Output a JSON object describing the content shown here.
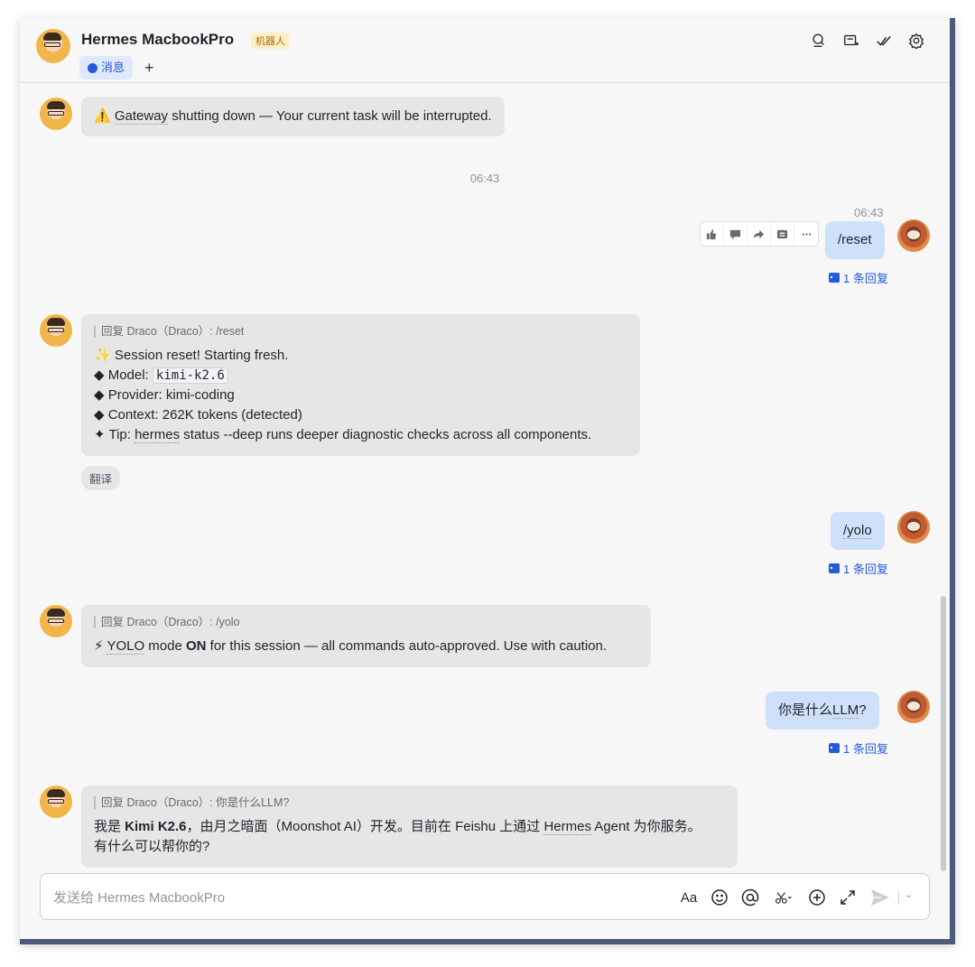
{
  "header": {
    "title": "Hermes MacbookPro",
    "badge": "机器人",
    "tab_label": "消息",
    "add_tab": "+",
    "icons": [
      "search-icon",
      "add-tab-icon",
      "check-icon",
      "settings-icon"
    ]
  },
  "messages": {
    "gateway": {
      "warn": "⚠️ ",
      "word": "Gateway",
      "rest": " shutting down — Your current task will be interrupted."
    },
    "time1": "06:43",
    "reset_time": "06:43",
    "reset_text": "/reset",
    "reply_count_1": "1 条回复",
    "reply_reset": {
      "quote": "回复 Draco（Draco）: /reset",
      "line1": "✨ Session reset! Starting fresh.",
      "line2_prefix": "◆ Model: ",
      "line2_code": "kimi-k2.6",
      "line3": "◆ Provider: kimi-coding",
      "line4": "◆ Context: 262K tokens (detected)",
      "line5_prefix": "✦ Tip: ",
      "line5_word": "hermes",
      "line5_rest": " status --deep runs deeper diagnostic checks across all components."
    },
    "translate": "翻译",
    "yolo_text": "/yolo",
    "reply_count_2": "1 条回复",
    "reply_yolo": {
      "quote": "回复 Draco（Draco）: /yolo",
      "prefix": "⚡ ",
      "word": "YOLO",
      "mid": " mode ",
      "bold": "ON",
      "rest": " for this session — all commands auto-approved. Use with caution."
    },
    "llm_q_prefix": "你是什么",
    "llm_q_word": "LLM",
    "llm_q_suffix": "?",
    "reply_count_3": "1 条回复",
    "reply_llm": {
      "quote": "回复 Draco（Draco）: 你是什么LLM?",
      "a": "我是 ",
      "bold": "Kimi K2.6",
      "b": "，由月之暗面（Moonshot AI）开发。目前在 Feishu 上通过 ",
      "word": "Hermes",
      "c": " Agent 为你服务。",
      "line2": "有什么可以帮你的?"
    }
  },
  "composer": {
    "placeholder": "发送给 Hermes MacbookPro",
    "font_btn": "Aa"
  }
}
